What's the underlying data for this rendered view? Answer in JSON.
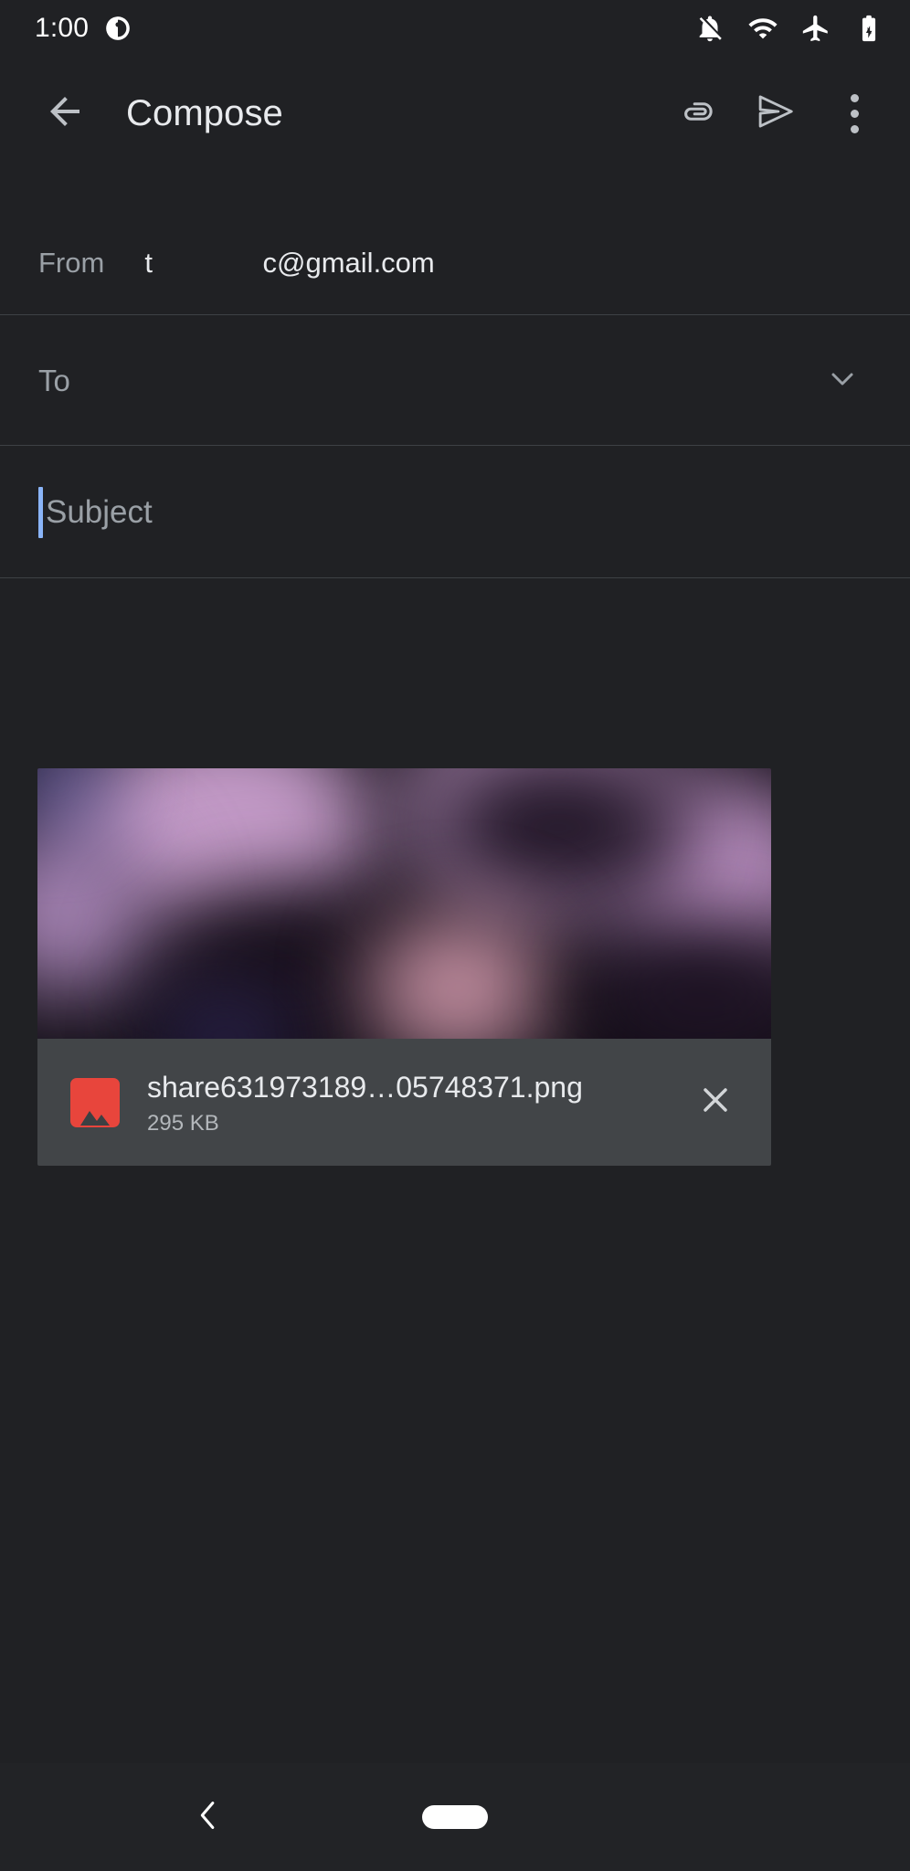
{
  "status_bar": {
    "clock": "1:00",
    "left_icons": [
      {
        "name": "app-activity-icon"
      }
    ],
    "right_icons": [
      {
        "name": "notifications-off-icon"
      },
      {
        "name": "wifi-icon"
      },
      {
        "name": "airplane-mode-icon"
      },
      {
        "name": "battery-charging-icon"
      }
    ]
  },
  "app_bar": {
    "back_label": "Back",
    "title": "Compose",
    "attach_label": "Attach file",
    "send_label": "Send",
    "more_label": "More options"
  },
  "fields": {
    "from": {
      "label": "From",
      "value": "t              c@gmail.com"
    },
    "to": {
      "label": "To",
      "placeholder": "To",
      "value": "",
      "expand_label": "Show Cc/Bcc"
    },
    "subject": {
      "label": "Subject",
      "placeholder": "Subject",
      "value": ""
    }
  },
  "attachment": {
    "file_name": "share631973189…05748371.png",
    "file_size": "295 KB",
    "type_icon": "image-icon",
    "remove_label": "Remove attachment",
    "thumbnail_alt": "Image preview"
  },
  "nav_bar": {
    "back_label": "Back",
    "home_label": "Home"
  },
  "colors": {
    "background": "#202124",
    "surface": "#424548",
    "divider": "#3e4145",
    "primary_text": "#e8eaed",
    "secondary_text": "#9aa0a6",
    "caret": "#8ab4f8",
    "accent_red": "#e8453c",
    "icon": "#bdc1c6"
  }
}
